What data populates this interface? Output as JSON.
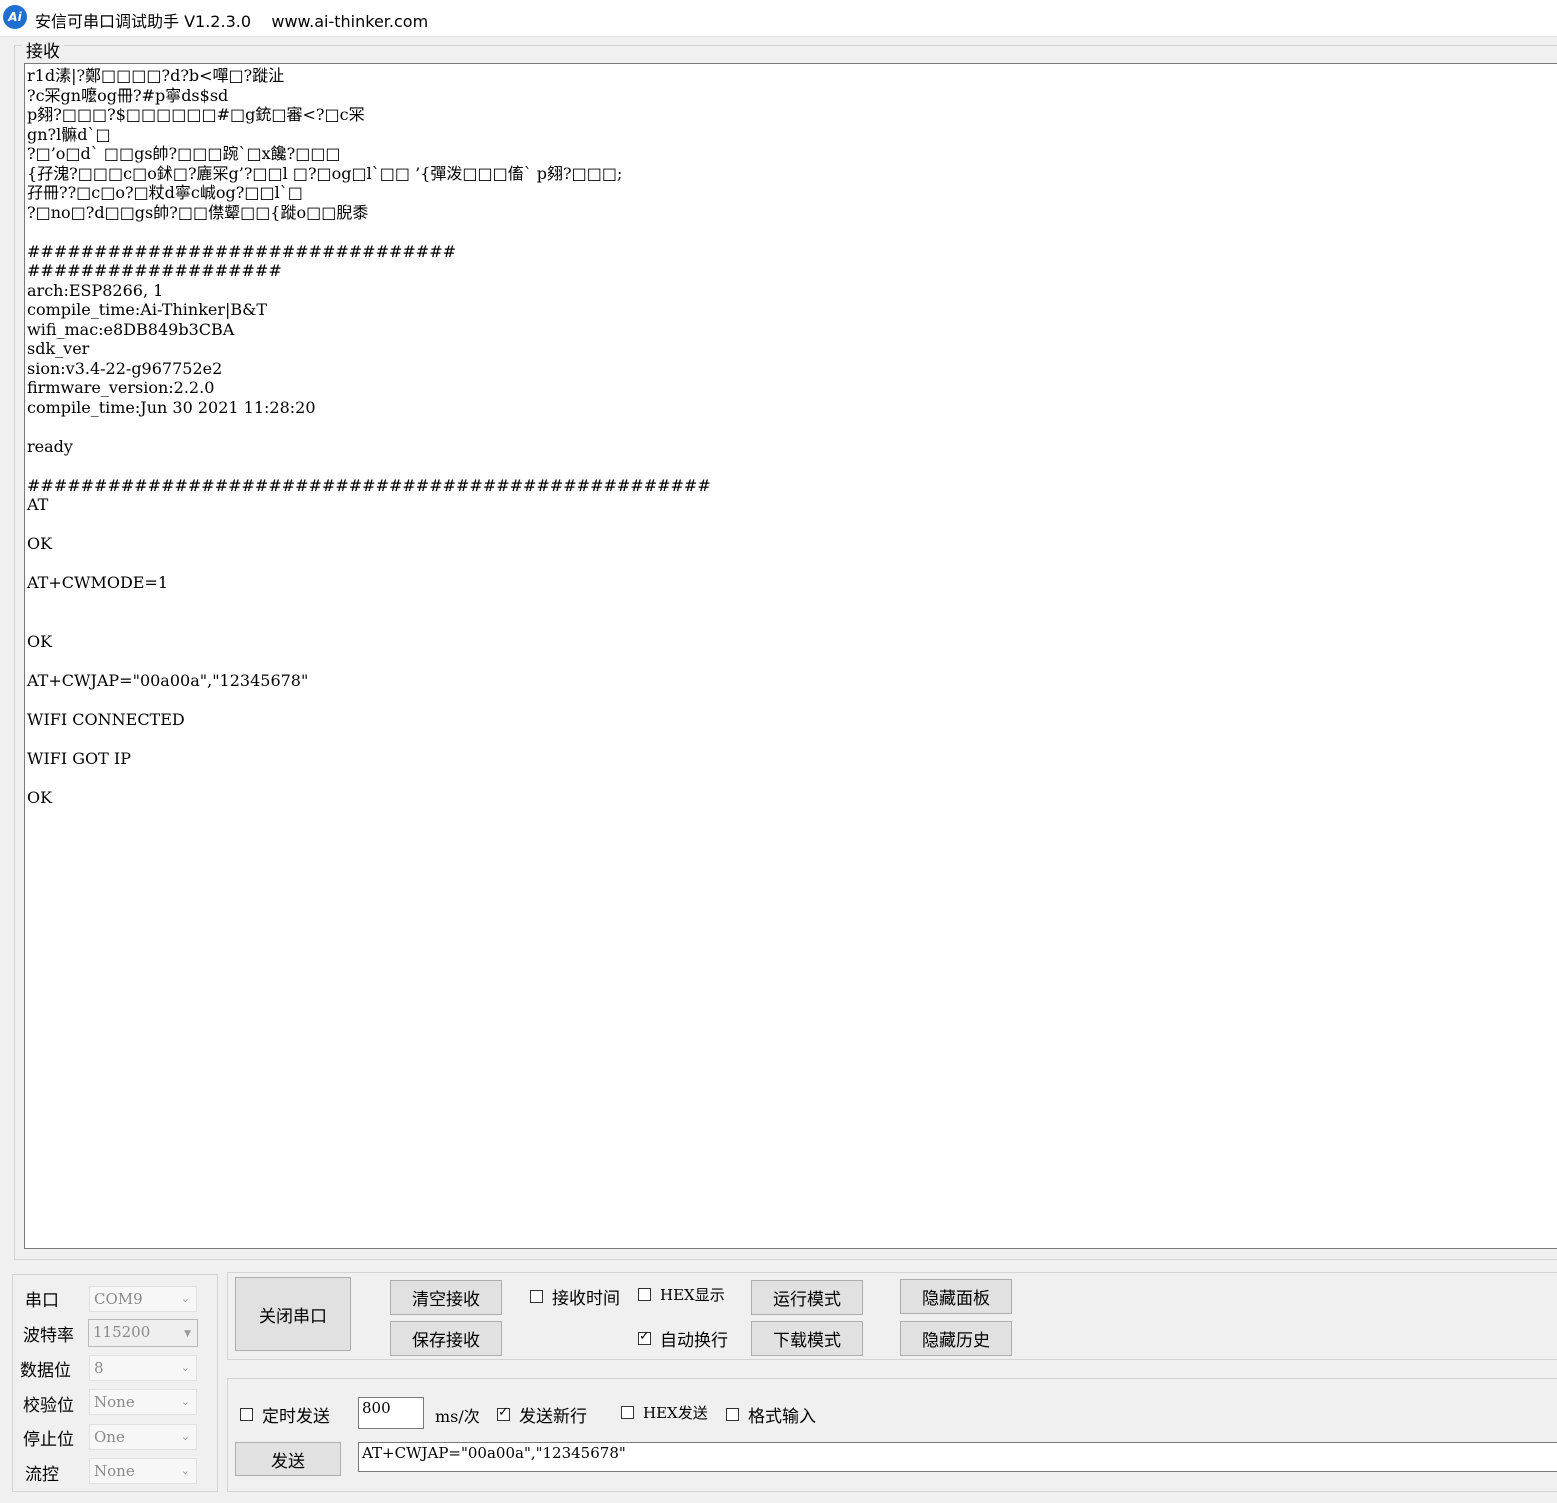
{
  "window": {
    "logo_text": "Ai",
    "title": "安信可串口调试助手 V1.2.3.0    www.ai-thinker.com"
  },
  "receive": {
    "legend": "接收",
    "lines": [
      "r1d溸|?鄭□□□□?d?b<嘽□?蹝沚",
      "?c冞gn嚒og冊?#p寧ds$sd",
      "p翗?□□□?$□□□□□□#□g銃□審<?□c冞",
      "gn?l髍d`□",
      "?□’o□d` □□gs帥?□□□踠`□x饞?□□□",
      "{孖溾?□□□c□o鉥□?廘冞g’?□□l □?□og□l`□□ ’{彈泼□□□傗` p翗?□□□;",
      "孖冊??□c□o?□粀d寧c峸og?□□l`□",
      "?□no□?d□□gs帥?□□僸颦□□{蹝o□□腉黍",
      "",
      "################################",
      "###################",
      "arch:ESP8266, 1",
      "compile_time:Ai-Thinker|B&T",
      "wifi_mac:e8DB849b3CBA",
      "sdk_ver",
      "sion:v3.4-22-g967752e2",
      "firmware_version:2.2.0",
      "compile_time:Jun 30 2021 11:28:20",
      "",
      "ready",
      "",
      "###################################################",
      "AT",
      "",
      "OK",
      "",
      "AT+CWMODE=1",
      "",
      "",
      "OK",
      "",
      "AT+CWJAP=\"00a00a\",\"12345678\"",
      "",
      "WIFI CONNECTED",
      "",
      "WIFI GOT IP",
      "",
      "OK"
    ]
  },
  "serial_settings": {
    "port_label": "串口",
    "port_value": "COM9",
    "baud_label": "波特率",
    "baud_value": "115200",
    "databits_label": "数据位",
    "databits_value": "8",
    "parity_label": "校验位",
    "parity_value": "None",
    "stopbits_label": "停止位",
    "stopbits_value": "One",
    "flow_label": "流控",
    "flow_value": "None"
  },
  "controls": {
    "close_port": "关闭串口",
    "clear_receive": "清空接收",
    "save_receive": "保存接收",
    "recv_time_label": "接收时间",
    "recv_time_checked": false,
    "hex_display_label": "HEX显示",
    "hex_display_checked": false,
    "auto_wrap_label": "自动换行",
    "auto_wrap_checked": true,
    "run_mode": "运行模式",
    "download_mode": "下载模式",
    "hide_panel": "隐藏面板",
    "hide_history": "隐藏历史"
  },
  "send": {
    "timed_send_label": "定时发送",
    "timed_send_checked": false,
    "interval_value": "800",
    "interval_unit": "ms/次",
    "send_newline_label": "发送新行",
    "send_newline_checked": true,
    "hex_send_label": "HEX发送",
    "hex_send_checked": false,
    "format_input_label": "格式输入",
    "format_input_checked": false,
    "send_button": "发送",
    "send_text": "AT+CWJAP=\"00a00a\",\"12345678\""
  }
}
